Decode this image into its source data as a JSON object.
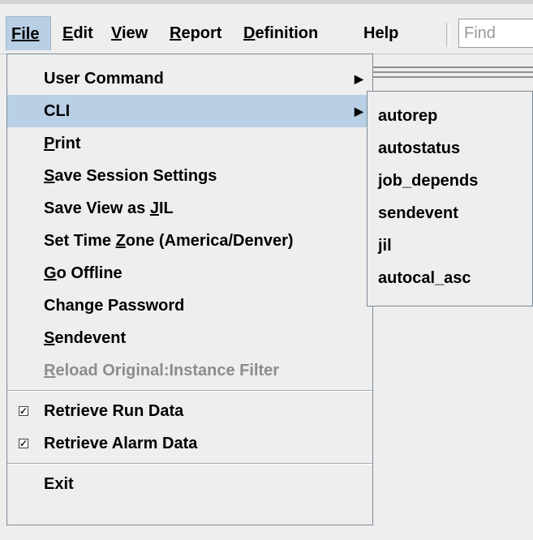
{
  "menubar": {
    "items": [
      {
        "label": "File",
        "mnemonic_index": 0
      },
      {
        "label": "Edit",
        "mnemonic_index": 0
      },
      {
        "label": "View",
        "mnemonic_index": 0
      },
      {
        "label": "Report",
        "mnemonic_index": 0
      },
      {
        "label": "Definition",
        "mnemonic_index": 0
      },
      {
        "label": "Help",
        "mnemonic_index": -1
      }
    ],
    "find_placeholder": "Find"
  },
  "file_menu": {
    "items": [
      {
        "label": "User Command",
        "submenu": true
      },
      {
        "label": "CLI",
        "submenu": true,
        "selected": true
      },
      {
        "label": "Print",
        "mnemonic": "P"
      },
      {
        "label": "Save Session Settings",
        "mnemonic": "S"
      },
      {
        "label": "Save View as JIL",
        "mnemonic": "J"
      },
      {
        "label": "Set Time Zone (America/Denver)",
        "mnemonic": "Z"
      },
      {
        "label": "Go Offline",
        "mnemonic": "G"
      },
      {
        "label": "Change Password"
      },
      {
        "label": "Sendevent",
        "mnemonic": "S"
      },
      {
        "label": "Reload Original:Instance Filter",
        "mnemonic": "R",
        "disabled": true
      },
      {
        "label": "Retrieve Run Data",
        "checked": true
      },
      {
        "label": "Retrieve Alarm Data",
        "checked": true
      },
      {
        "label": "Exit"
      }
    ]
  },
  "cli_submenu": {
    "items": [
      "autorep",
      "autostatus",
      "job_depends",
      "sendevent",
      "jil",
      "autocal_asc"
    ]
  },
  "colors": {
    "selection": "#b8cfe5",
    "menu_bg": "#eeeeee",
    "disabled_text": "#8c8c8c"
  }
}
